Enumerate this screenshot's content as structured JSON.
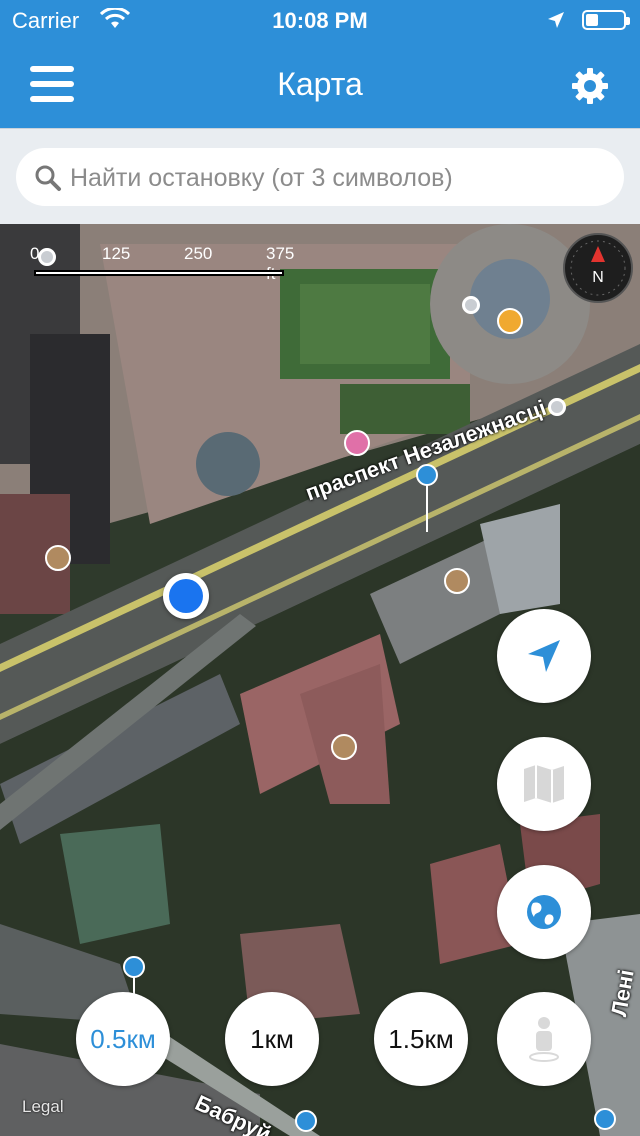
{
  "status_bar": {
    "carrier": "Carrier",
    "time": "10:08 PM"
  },
  "header": {
    "title": "Карта",
    "menu_icon": "hamburger-menu-icon",
    "settings_icon": "gear-icon"
  },
  "search": {
    "placeholder": "Найти остановку (от 3 символов)",
    "value": ""
  },
  "map": {
    "scale": {
      "labels": [
        "0",
        "125",
        "250",
        "375 ft"
      ]
    },
    "road_labels": {
      "main": "праспект Незалежнасці",
      "bottom": "Бабруй",
      "right": "Лені"
    },
    "legal": "Legal"
  },
  "controls": {
    "locate_icon": "location-arrow-icon",
    "map_type_icon": "map-icon",
    "globe_icon": "globe-icon",
    "street_view_icon": "person-icon"
  },
  "radius_buttons": [
    {
      "label": "0.5км",
      "active": true
    },
    {
      "label": "1км",
      "active": false
    },
    {
      "label": "1.5км",
      "active": false
    }
  ],
  "colors": {
    "header": "#2d8fd8",
    "accent": "#2d8fd8",
    "user_location": "#1a74ef"
  }
}
